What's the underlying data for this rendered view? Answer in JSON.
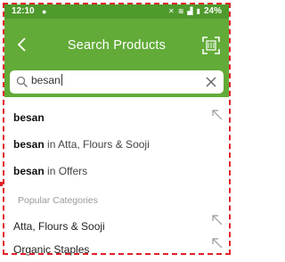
{
  "status_bar": {
    "time": "12:10",
    "right_text": "24%",
    "icons": [
      "chat-bubble-icon",
      "silent-icon",
      "wifi-icon",
      "signal-icon",
      "battery-icon"
    ]
  },
  "header": {
    "title": "Search Products",
    "icons": [
      "back-arrow-icon",
      "barcode-scanner-icon"
    ],
    "background_color": "#62ab38",
    "status_color": "#4f9a2c"
  },
  "search": {
    "value": "besan",
    "icons": [
      "search-icon",
      "clear-icon"
    ]
  },
  "suggestions": [
    {
      "query": "besan",
      "suffix": ""
    },
    {
      "query": "besan",
      "suffix": " in Atta, Flours & Sooji"
    },
    {
      "query": "besan",
      "suffix": " in Offers"
    }
  ],
  "popular_categories": {
    "heading": "Popular Categories",
    "items": [
      "Atta, Flours & Sooji",
      "Organic Staples"
    ]
  },
  "accent_color": "#e0202a"
}
